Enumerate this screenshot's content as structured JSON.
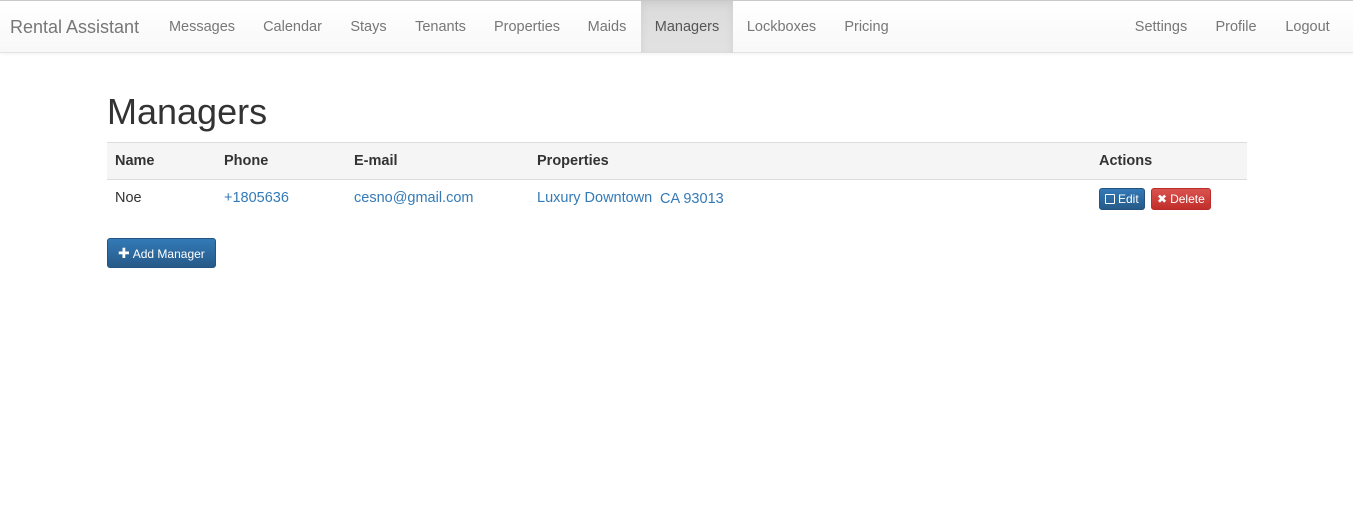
{
  "nav": {
    "brand": "Rental Assistant",
    "items": [
      {
        "label": "Messages"
      },
      {
        "label": "Calendar"
      },
      {
        "label": "Stays"
      },
      {
        "label": "Tenants"
      },
      {
        "label": "Properties"
      },
      {
        "label": "Maids"
      },
      {
        "label": "Managers",
        "active": true
      },
      {
        "label": "Lockboxes"
      },
      {
        "label": "Pricing"
      }
    ],
    "right_items": [
      {
        "label": "Settings"
      },
      {
        "label": "Profile"
      },
      {
        "label": "Logout"
      }
    ]
  },
  "page": {
    "title": "Managers"
  },
  "table": {
    "headers": [
      "Name",
      "Phone",
      "E-mail",
      "Properties",
      "Actions"
    ],
    "rows": [
      {
        "name": "Noe",
        "phone": "+1805636",
        "email": "cesno@gmail.com",
        "properties": [
          "Luxury Downtown",
          "CA 93013"
        ],
        "actions": {
          "edit": "Edit",
          "delete": "Delete"
        }
      }
    ]
  },
  "buttons": {
    "add_manager": "Add Manager"
  },
  "colors": {
    "link": "#337ab7",
    "primary": "#337ab7",
    "danger": "#d9534f",
    "navbar_text": "#777777"
  },
  "icons": {
    "edit": "edit-icon",
    "delete": "close-icon",
    "add": "plus-icon"
  }
}
